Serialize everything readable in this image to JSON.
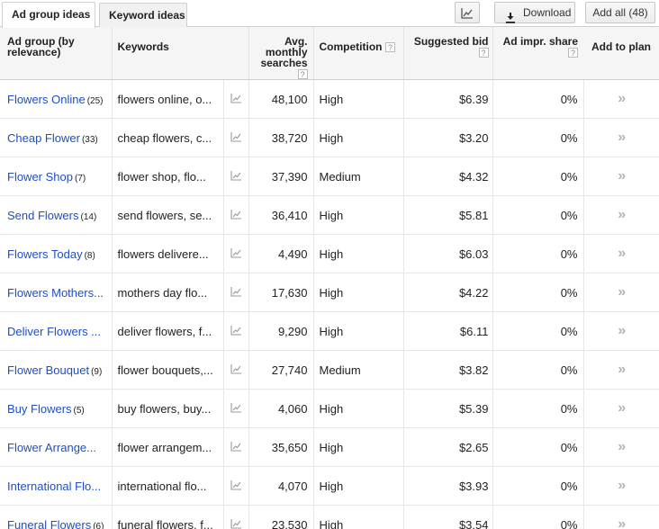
{
  "tabs": {
    "ad_group_ideas": "Ad group ideas",
    "keyword_ideas": "Keyword ideas"
  },
  "toolbar": {
    "chart_icon": "line-chart-icon",
    "download_label": "Download",
    "add_all_label": "Add all (48)"
  },
  "table": {
    "headers": {
      "ad_group": "Ad group (by relevance)",
      "keywords": "Keywords",
      "avg_monthly_searches": "Avg. monthly searches",
      "competition": "Competition",
      "suggested_bid": "Suggested bid",
      "ad_impr_share": "Ad impr. share",
      "add_to_plan": "Add to plan",
      "help_glyph": "?"
    },
    "add_icon_glyph": "»",
    "rows": [
      {
        "group": "Flowers Online",
        "count": "(25)",
        "keywords": "flowers online, o...",
        "searches": "48,100",
        "competition": "High",
        "bid": "$6.39",
        "share": "0%"
      },
      {
        "group": "Cheap Flower",
        "count": "(33)",
        "keywords": "cheap flowers, c...",
        "searches": "38,720",
        "competition": "High",
        "bid": "$3.20",
        "share": "0%"
      },
      {
        "group": "Flower Shop",
        "count": "(7)",
        "keywords": "flower shop, flo...",
        "searches": "37,390",
        "competition": "Medium",
        "bid": "$4.32",
        "share": "0%"
      },
      {
        "group": "Send Flowers",
        "count": "(14)",
        "keywords": "send flowers, se...",
        "searches": "36,410",
        "competition": "High",
        "bid": "$5.81",
        "share": "0%"
      },
      {
        "group": "Flowers Today",
        "count": "(8)",
        "keywords": "flowers delivere...",
        "searches": "4,490",
        "competition": "High",
        "bid": "$6.03",
        "share": "0%"
      },
      {
        "group": "Flowers Mothers...",
        "count": "",
        "keywords": "mothers day flo...",
        "searches": "17,630",
        "competition": "High",
        "bid": "$4.22",
        "share": "0%"
      },
      {
        "group": "Deliver Flowers ...",
        "count": "",
        "keywords": "deliver flowers, f...",
        "searches": "9,290",
        "competition": "High",
        "bid": "$6.11",
        "share": "0%"
      },
      {
        "group": "Flower Bouquet",
        "count": "(9)",
        "keywords": "flower bouquets,...",
        "searches": "27,740",
        "competition": "Medium",
        "bid": "$3.82",
        "share": "0%"
      },
      {
        "group": "Buy Flowers",
        "count": "(5)",
        "keywords": "buy flowers, buy...",
        "searches": "4,060",
        "competition": "High",
        "bid": "$5.39",
        "share": "0%"
      },
      {
        "group": "Flower Arrange...",
        "count": "",
        "keywords": "flower arrangem...",
        "searches": "35,650",
        "competition": "High",
        "bid": "$2.65",
        "share": "0%"
      },
      {
        "group": "International Flo...",
        "count": "",
        "keywords": "international flo...",
        "searches": "4,070",
        "competition": "High",
        "bid": "$3.93",
        "share": "0%"
      },
      {
        "group": "Funeral Flowers",
        "count": "(6)",
        "keywords": "funeral flowers, f...",
        "searches": "23,530",
        "competition": "High",
        "bid": "$3.54",
        "share": "0%"
      }
    ]
  }
}
